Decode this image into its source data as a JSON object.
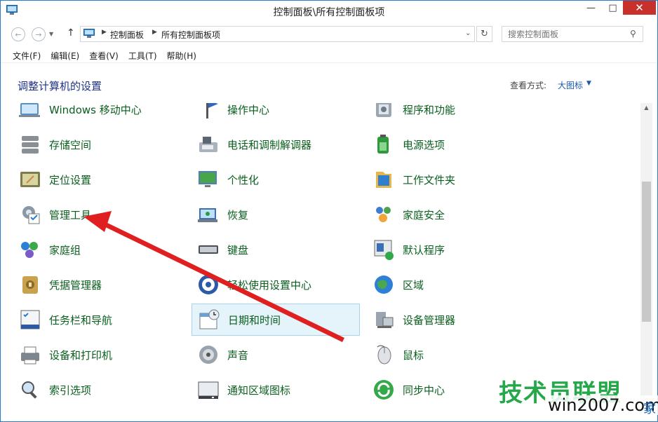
{
  "window": {
    "title": "控制面板\\所有控制面板项"
  },
  "address": {
    "crumbs": [
      "控制面板",
      "所有控制面板项"
    ]
  },
  "search": {
    "placeholder": "搜索控制面板"
  },
  "menu": [
    "文件(F)",
    "编辑(E)",
    "查看(V)",
    "工具(T)",
    "帮助(H)"
  ],
  "content": {
    "heading": "调整计算机的设置",
    "view_label": "查看方式:",
    "view_value": "大图标"
  },
  "items": [
    [
      "Windows 移动中心",
      "操作中心",
      "程序和功能"
    ],
    [
      "存储空间",
      "电话和调制解调器",
      "电源选项"
    ],
    [
      "定位设置",
      "个性化",
      "工作文件夹"
    ],
    [
      "管理工具",
      "恢复",
      "家庭安全"
    ],
    [
      "家庭组",
      "键盘",
      "默认程序"
    ],
    [
      "凭据管理器",
      "轻松使用设置中心",
      "区域"
    ],
    [
      "任务栏和导航",
      "日期和时间",
      "设备管理器"
    ],
    [
      "设备和打印机",
      "声音",
      "鼠标"
    ],
    [
      "索引选项",
      "通知区域图标",
      "同步中心"
    ]
  ],
  "selected_item": "日期和时间",
  "icons": [
    [
      "mobility-center-icon",
      "action-center-icon",
      "programs-features-icon"
    ],
    [
      "storage-spaces-icon",
      "phone-modem-icon",
      "power-options-icon"
    ],
    [
      "location-settings-icon",
      "personalization-icon",
      "work-folders-icon"
    ],
    [
      "admin-tools-icon",
      "recovery-icon",
      "family-safety-icon"
    ],
    [
      "homegroup-icon",
      "keyboard-icon",
      "default-programs-icon"
    ],
    [
      "credential-manager-icon",
      "ease-of-access-icon",
      "region-icon"
    ],
    [
      "taskbar-navigation-icon",
      "date-time-icon",
      "device-manager-icon"
    ],
    [
      "devices-printers-icon",
      "sound-icon",
      "mouse-icon"
    ],
    [
      "indexing-options-icon",
      "notification-icons-icon",
      "sync-center-icon"
    ]
  ],
  "watermark": {
    "title": "技术员联盟",
    "url": "win2007.com",
    "tail": "家"
  },
  "colors": {
    "item_text": "#0a5f1e",
    "heading": "#1e3287",
    "close_button": "#c7302b",
    "annotation_arrow": "#e02020",
    "selection_bg": "#e5f3fb"
  }
}
